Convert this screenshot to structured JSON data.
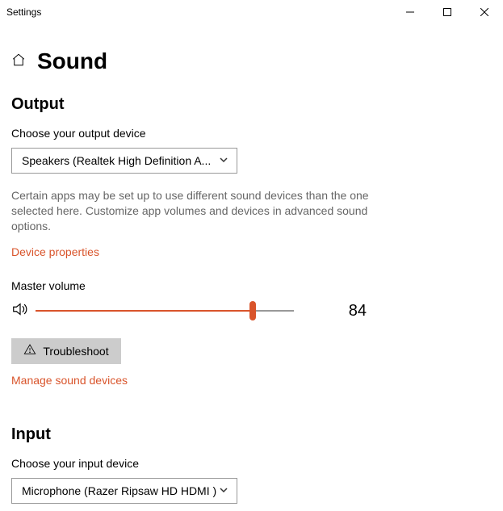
{
  "window": {
    "title": "Settings"
  },
  "page": {
    "title": "Sound"
  },
  "output": {
    "heading": "Output",
    "choose_label": "Choose your output device",
    "device": "Speakers (Realtek High Definition A...",
    "desc": "Certain apps may be set up to use different sound devices than the one selected here. Customize app volumes and devices in advanced sound options.",
    "device_properties": "Device properties",
    "master_volume_label": "Master volume",
    "master_volume_value": "84",
    "master_volume_percent": 84,
    "troubleshoot": "Troubleshoot",
    "manage": "Manage sound devices"
  },
  "input": {
    "heading": "Input",
    "choose_label": "Choose your input device",
    "device": "Microphone (Razer Ripsaw HD HDMI )"
  }
}
